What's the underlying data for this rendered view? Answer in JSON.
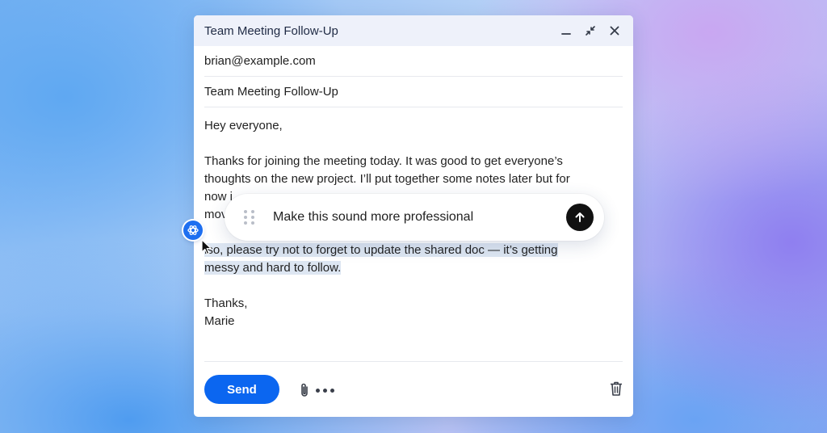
{
  "window": {
    "title": "Team Meeting Follow-Up"
  },
  "email": {
    "to": "brian@example.com",
    "subject": "Team Meeting Follow-Up",
    "greeting": "Hey everyone,",
    "paragraph1_lines": [
      "Thanks for joining the meeting today. It was good to get everyone’s",
      "thoughts on the new project. I’ll put together some notes later but for",
      "now i",
      "mov"
    ],
    "paragraph2_lines": [
      "lso, please try not to forget to update the shared doc — it’s getting",
      "messy and hard to follow."
    ],
    "signoff": "Thanks,",
    "signature": "Marie"
  },
  "toolbar": {
    "send_label": "Send"
  },
  "prompt": {
    "value": "Make this sound more professional"
  },
  "icons": {
    "minimize": "minimize-icon",
    "collapse": "collapse-icon",
    "close": "close-icon",
    "attach": "paperclip-icon",
    "more": "more-dots-icon",
    "trash": "trash-icon",
    "grip": "drag-grip-icon",
    "submit": "arrow-up-icon",
    "ai": "openai-logo-icon",
    "cursor": "mouse-pointer-icon"
  },
  "colors": {
    "accent": "#0b66f0",
    "selection": "#dde6f2",
    "titlebar": "#eef1fa",
    "ai_badge": "#1e6ff0"
  }
}
